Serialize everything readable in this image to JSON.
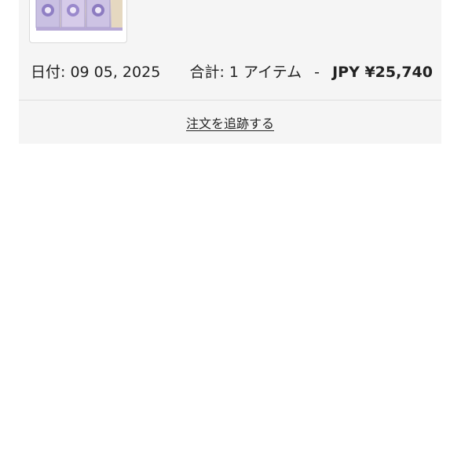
{
  "order": {
    "date_label": "日付:",
    "date_value": "09 05, 2025",
    "total_label": "合計:",
    "item_count": "1 アイテム",
    "separator": "-",
    "price": "JPY ¥25,740",
    "product_image_icon": "product-boxes-image"
  },
  "actions": {
    "track_order_label": "注文を追跡する"
  },
  "colors": {
    "card_background": "#f5f5f5",
    "text": "#222222",
    "divider": "#dedede"
  }
}
